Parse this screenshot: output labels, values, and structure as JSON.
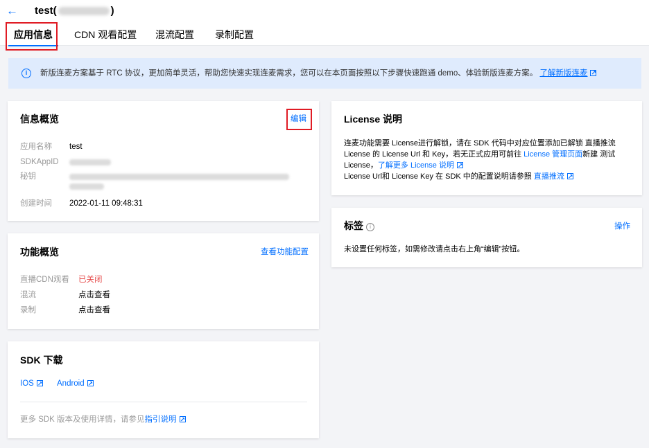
{
  "header": {
    "title_prefix": "test(",
    "title_suffix": ")",
    "tabs": [
      "应用信息",
      "CDN 观看配置",
      "混流配置",
      "录制配置"
    ]
  },
  "banner": {
    "text": "新版连麦方案基于 RTC 协议，更加简单灵活，帮助您快速实现连麦需求，您可以在本页面按照以下步骤快速跑通 demo、体验新版连麦方案。",
    "link": "了解新版连麦"
  },
  "info": {
    "title": "信息概览",
    "edit": "编辑",
    "labels": [
      "应用名称",
      "SDKAppID",
      "秘钥",
      "创建时间"
    ],
    "app_name": "test",
    "created": "2022-01-11 09:48:31"
  },
  "func": {
    "title": "功能概览",
    "view_config": "查看功能配置",
    "labels": [
      "直播CDN观看",
      "混流",
      "录制"
    ],
    "values": [
      "已关闭",
      "点击查看",
      "点击查看"
    ]
  },
  "sdk": {
    "title": "SDK 下载",
    "ios": "IOS",
    "android": "Android",
    "footer_text": "更多 SDK 版本及使用详情，请参见",
    "footer_link": "指引说明"
  },
  "license": {
    "title": "License 说明",
    "line1": "连麦功能需要 License进行解锁，请在 SDK 代码中对应位置添加已解锁 直播推流",
    "line2_a": "License 的 License Url 和 Key，若无正式应用可前往 ",
    "line2_link": "License 管理页面",
    "line2_b": "新建 测试",
    "line3_a": "License，",
    "line3_link": "了解更多 License 说明",
    "line4_a": "License Url和 License Key 在 SDK 中的配置说明请参照 ",
    "line4_link": "直播推流"
  },
  "tags": {
    "title": "标签",
    "action": "操作",
    "empty": "未设置任何标签，如需修改请点击右上角“编辑”按钮。"
  },
  "colors": {
    "accent": "#006eff",
    "highlight_box": "#e01b24",
    "status_off": "#e54545",
    "banner_bg": "#dfebfd"
  },
  "icons": {
    "back": "arrow-left-icon",
    "info": "info-circle-icon",
    "external": "external-link-icon",
    "help": "help-circle-icon"
  }
}
